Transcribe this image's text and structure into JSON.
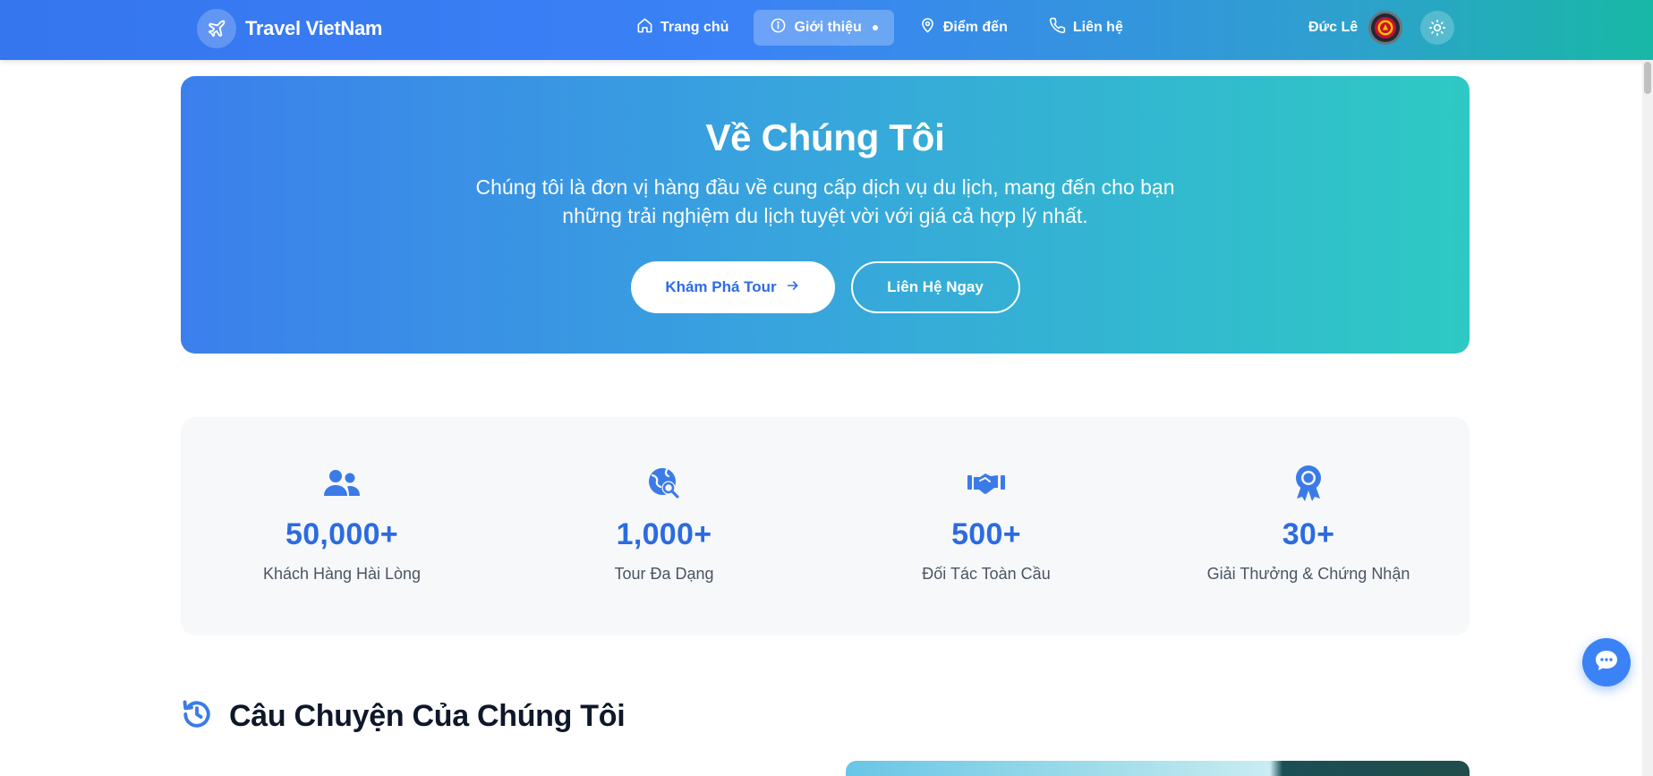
{
  "nav": {
    "brand": "Travel VietNam",
    "links": [
      {
        "label": "Trang chủ",
        "icon": "home-icon"
      },
      {
        "label": "Giới thiệu",
        "icon": "info-icon",
        "active": true
      },
      {
        "label": "Điểm đến",
        "icon": "map-pin-icon"
      },
      {
        "label": "Liên hệ",
        "icon": "phone-icon"
      }
    ],
    "user_name": "Đức Lê"
  },
  "hero": {
    "title": "Về Chúng Tôi",
    "description": "Chúng tôi là đơn vị hàng đầu về cung cấp dịch vụ du lịch, mang đến cho bạn những trải nghiệm du lịch tuyệt vời với giá cả hợp lý nhất.",
    "primary_button": "Khám Phá Tour",
    "secondary_button": "Liên Hệ Ngay"
  },
  "stats": [
    {
      "value": "50,000+",
      "label": "Khách Hàng Hài Lòng",
      "icon": "users-icon"
    },
    {
      "value": "1,000+",
      "label": "Tour Đa Dạng",
      "icon": "globe-search-icon"
    },
    {
      "value": "500+",
      "label": "Đối Tác Toàn Cầu",
      "icon": "handshake-icon"
    },
    {
      "value": "30+",
      "label": "Giải Thưởng & Chứng Nhận",
      "icon": "award-icon"
    }
  ],
  "story": {
    "title": "Câu Chuyện Của Chúng Tôi",
    "icon": "history-icon"
  },
  "colors": {
    "primary": "#3b82f6",
    "accent_text": "#2c6be0",
    "teal": "#2ec9c4"
  }
}
